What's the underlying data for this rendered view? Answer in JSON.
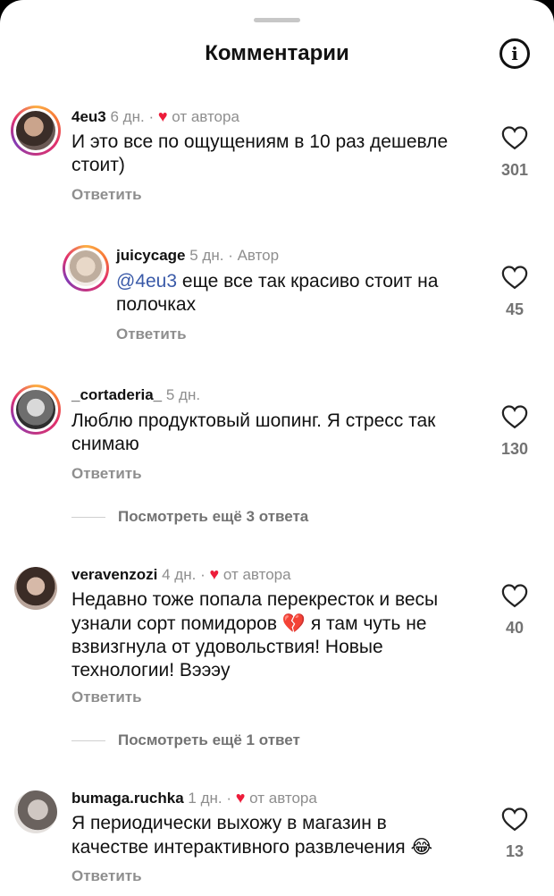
{
  "header": {
    "title": "Комментарии"
  },
  "comments": [
    {
      "username": "4eu3",
      "time": "6 дн.",
      "author_like": "от автора",
      "text": "И это все по ощущениям в 10 раз дешевле стоит)",
      "reply_label": "Ответить",
      "likes": "301"
    },
    {
      "username": "juicycage",
      "time": "5 дн.",
      "badge": "Автор",
      "mention": "@4eu3",
      "text": "еще все так красиво стоит на полочках",
      "reply_label": "Ответить",
      "likes": "45"
    },
    {
      "username": "_cortaderia_",
      "time": "5 дн.",
      "text": "Люблю продуктовый шопинг. Я стресс так снимаю",
      "reply_label": "Ответить",
      "likes": "130",
      "view_more": "Посмотреть ещё 3 ответа"
    },
    {
      "username": "veravenzozi",
      "time": "4 дн.",
      "author_like": "от автора",
      "text_line1": "Недавно тоже попала перекресток и весы",
      "text_line2": "узнали сорт помидоров",
      "emoji": "💔",
      "text_line2b": "я там чуть не",
      "text_line3": "взвизгнула от удовольствия! Новые",
      "text_line4": "технологии! Вэээу",
      "reply_label": "Ответить",
      "likes": "40",
      "view_more": "Посмотреть ещё 1 ответ"
    },
    {
      "username": "bumaga.ruchka",
      "time": "1 дн.",
      "author_like": "от автора",
      "text_line1": "Я периодически выхожу в магазин в",
      "text_line2": "качестве интерактивного развлечения",
      "emoji": "😂",
      "reply_label": "Ответить",
      "likes": "13"
    }
  ],
  "colors": {
    "heart": "#ed1c3a",
    "mention": "#3a5aa8",
    "secondary": "#8e8e8e"
  }
}
